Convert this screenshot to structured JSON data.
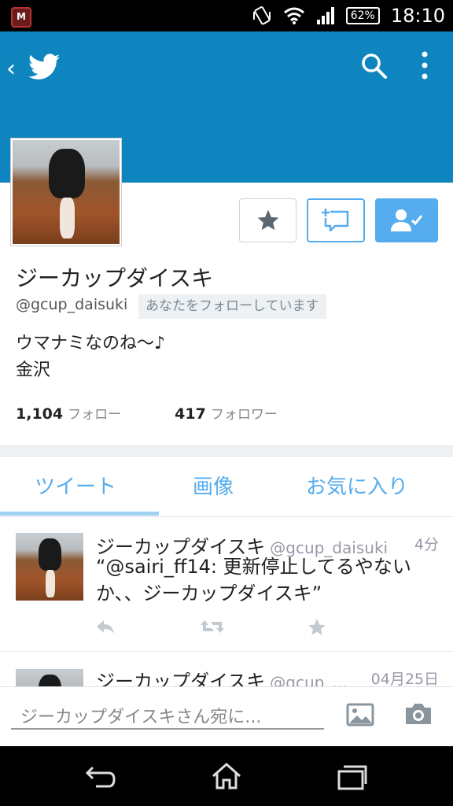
{
  "status_bar": {
    "app_icon_letter": "M",
    "battery": "62%",
    "time": "18:10"
  },
  "profile": {
    "name": "ジーカップダイスキ",
    "handle": "@gcup_daisuki",
    "follows_you": "あなたをフォローしています",
    "bio_line1": "ウマナミなのね～♪",
    "bio_line2": "金沢",
    "following_count": "1,104",
    "following_label": "フォロー",
    "followers_count": "417",
    "followers_label": "フォロワー"
  },
  "tabs": [
    {
      "label": "ツイート"
    },
    {
      "label": "画像"
    },
    {
      "label": "お気に入り"
    }
  ],
  "tweets": [
    {
      "name": "ジーカップダイスキ",
      "handle": "@gcup_daisuki",
      "time": "4分",
      "text": "“@sairi_ff14: 更新停止してるやないか、、ジーカップダイスキ”"
    },
    {
      "name": "ジーカップダイスキ",
      "handle": "@gcup_...",
      "time": "04月25日",
      "text": ""
    }
  ],
  "composer": {
    "placeholder": "ジーカップダイスキさん宛に..."
  },
  "colors": {
    "header_blue": "#0e85bf",
    "twitter_blue": "#55acee"
  },
  "icons": [
    "back-arrow-icon",
    "twitter-bird-icon",
    "search-icon",
    "overflow-menu-icon",
    "star-icon",
    "direct-message-icon",
    "following-icon",
    "reply-icon",
    "retweet-icon",
    "favorite-icon",
    "image-icon",
    "camera-icon",
    "nav-back-icon",
    "nav-home-icon",
    "nav-recents-icon"
  ]
}
